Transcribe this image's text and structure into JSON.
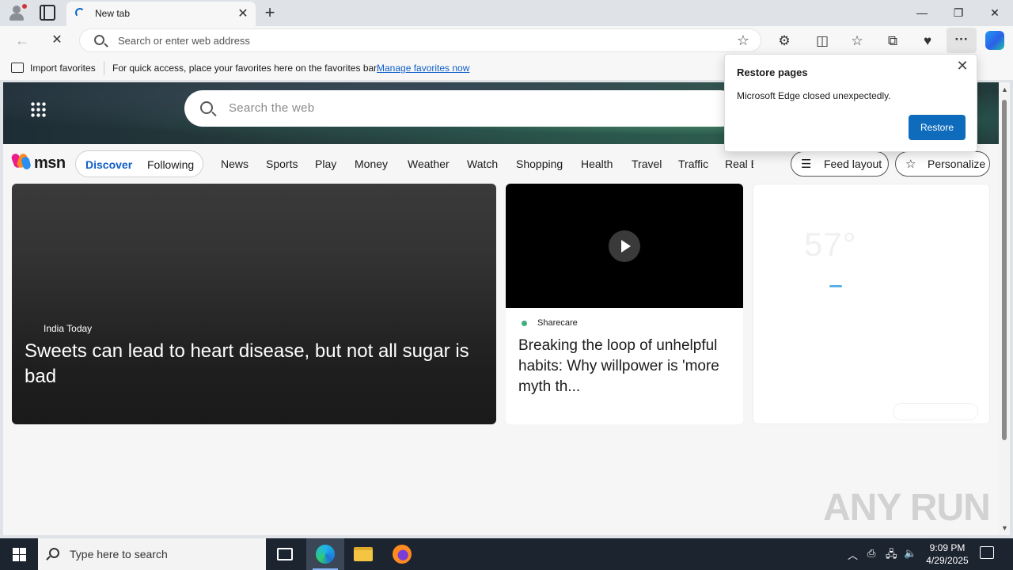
{
  "browser": {
    "tab_title": "New tab",
    "address_placeholder": "Search or enter web address",
    "favorites_bar": {
      "import_label": "Import favorites",
      "message": "For quick access, place your favorites here on the favorites bar.",
      "manage_link": "Manage favorites now"
    }
  },
  "msn": {
    "search_placeholder": "Search the web",
    "logo_text": "msn",
    "toggle": {
      "discover": "Discover",
      "following": "Following"
    },
    "nav_items": [
      "News",
      "Sports",
      "Play",
      "Money",
      "Weather",
      "Watch",
      "Shopping",
      "Health",
      "Travel",
      "Traffic",
      "Real E"
    ],
    "feed_layout_label": "Feed layout",
    "personalize_label": "Personalize",
    "cards": {
      "main": {
        "source": "India Today",
        "headline": "Sweets can lead to heart disease, but not all sugar is bad"
      },
      "video": {
        "source": "Sharecare",
        "headline": "Breaking the loop of unhelpful habits: Why willpower is 'more myth th..."
      },
      "weather": {
        "temperature": "57°"
      }
    }
  },
  "popup": {
    "title": "Restore pages",
    "body": "Microsoft Edge closed unexpectedly.",
    "button": "Restore"
  },
  "watermark": "ANY RUN",
  "taskbar": {
    "search_placeholder": "Type here to search",
    "time": "9:09 PM",
    "date": "4/29/2025"
  },
  "colors": {
    "accent": "#0f6cbd",
    "link": "#0f5ec9",
    "taskbar": "#1c2430"
  }
}
